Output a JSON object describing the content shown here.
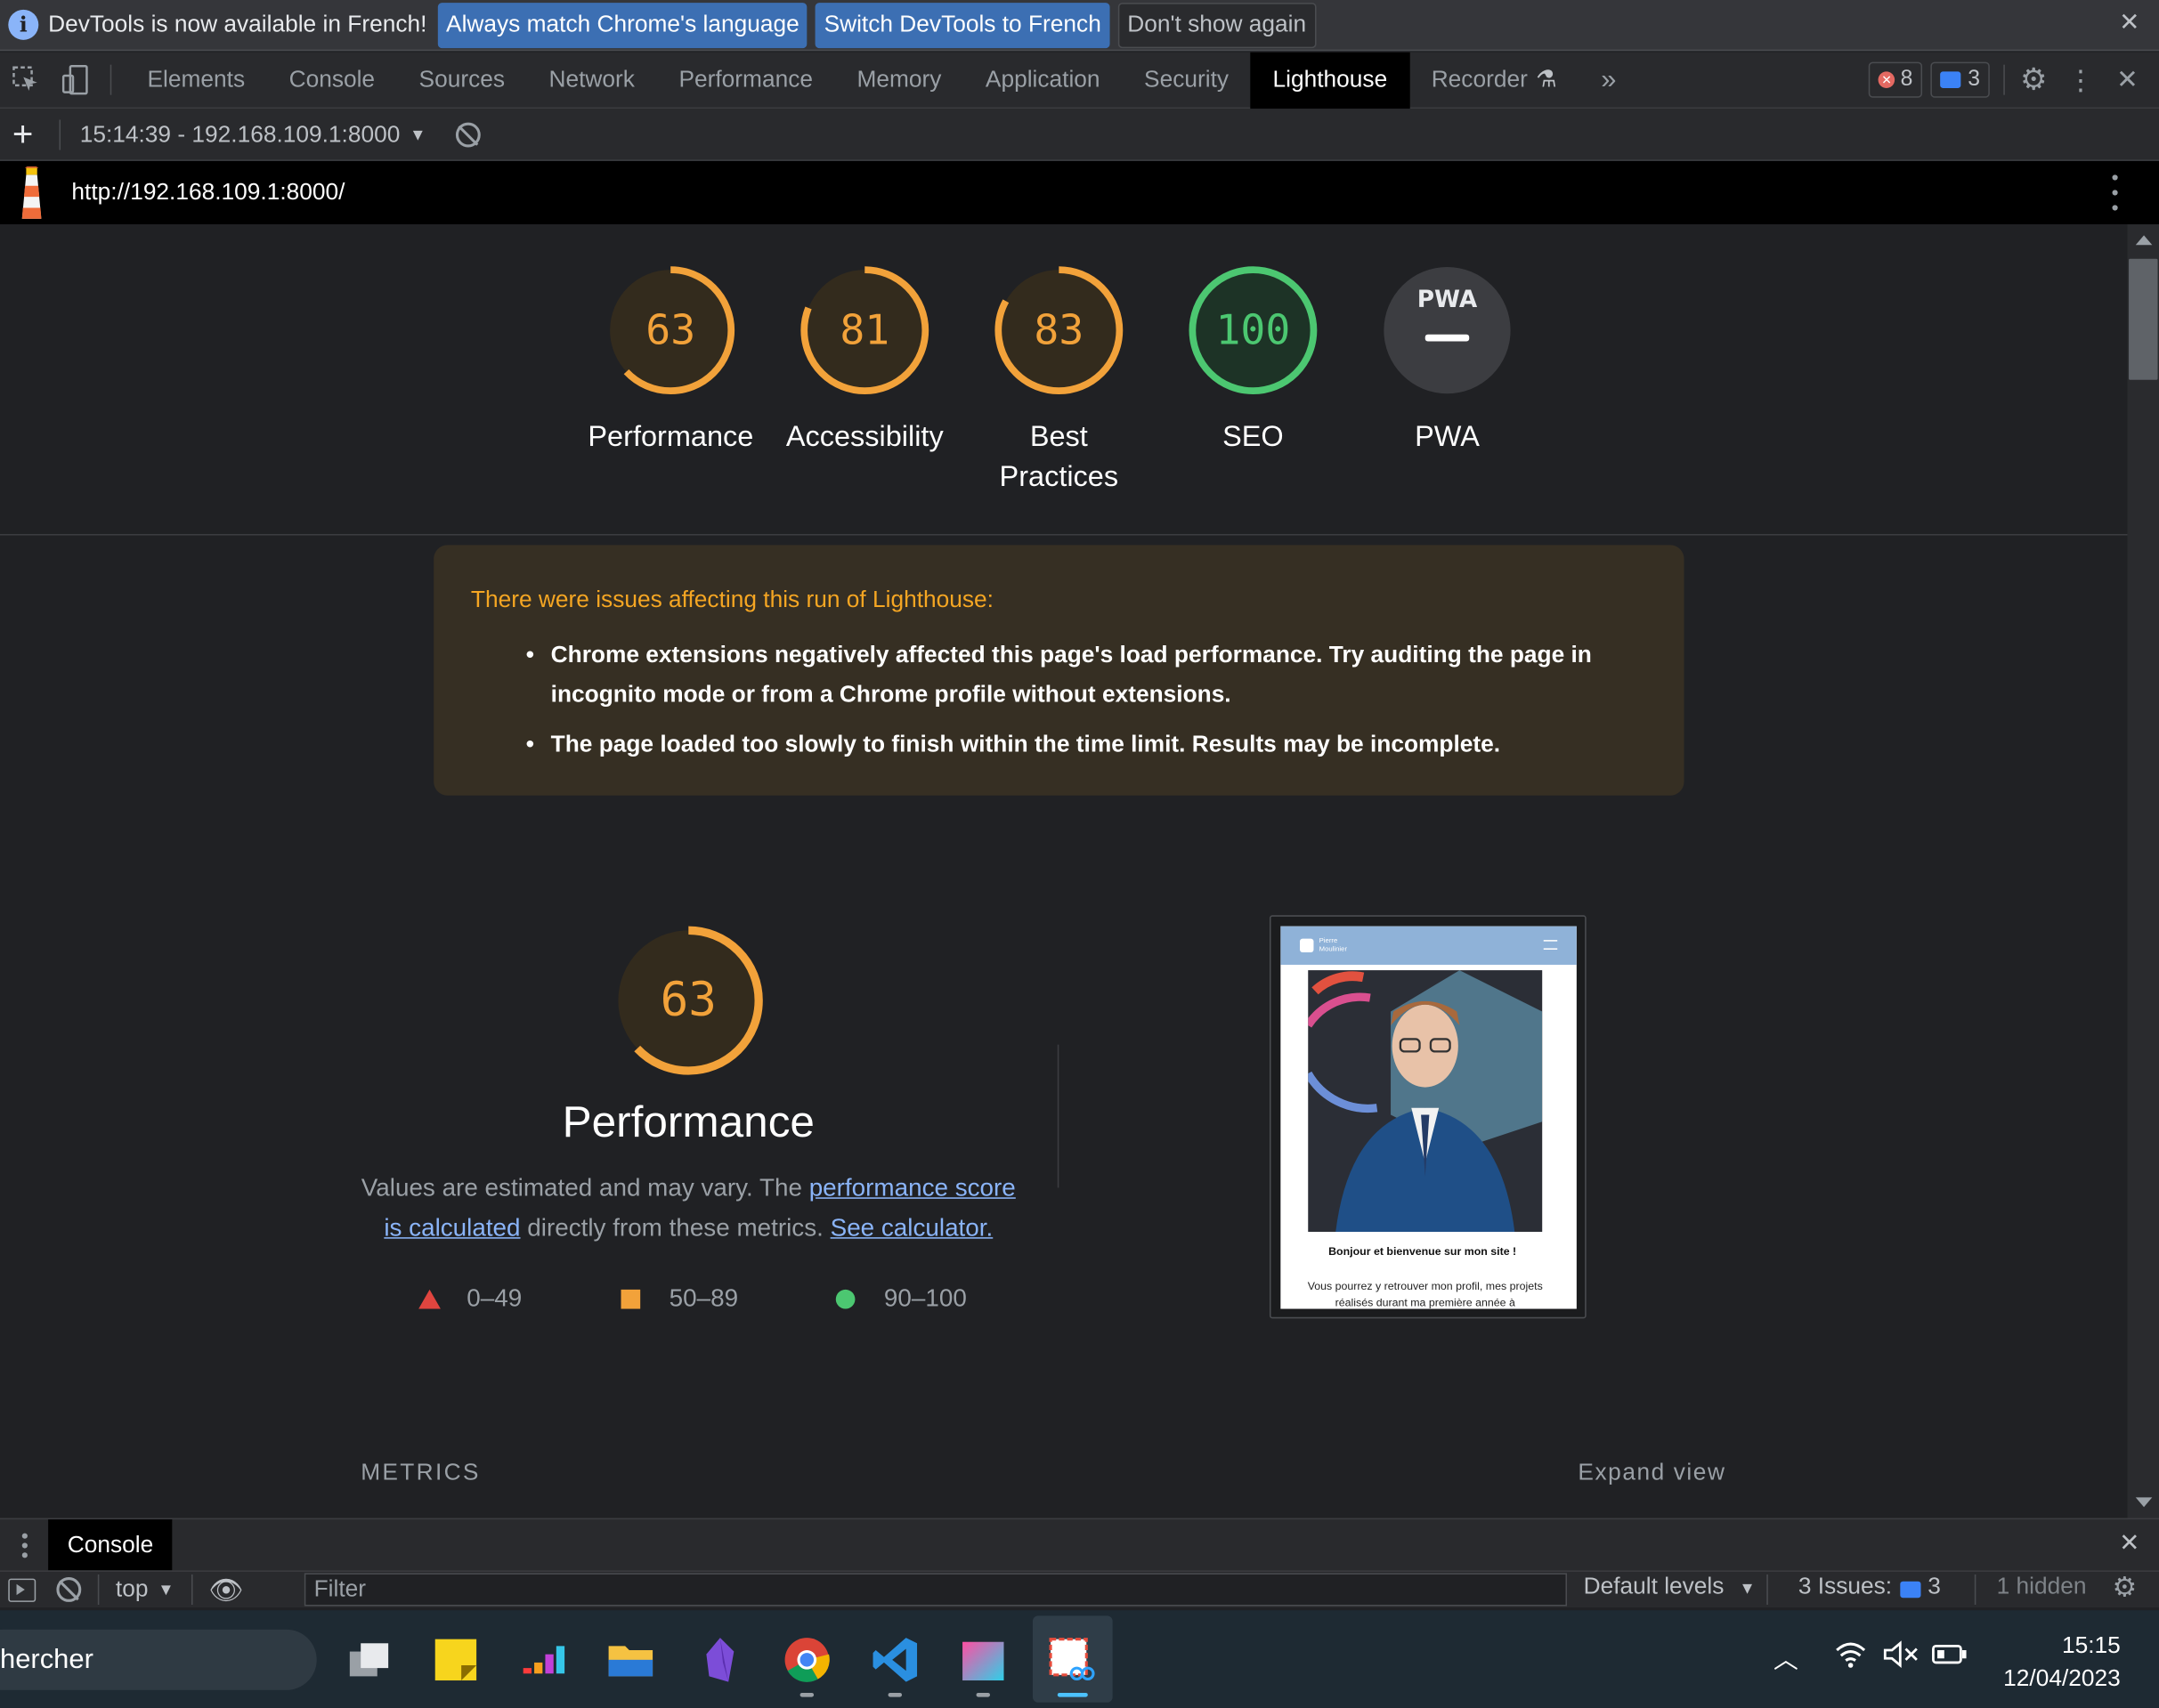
{
  "infobar": {
    "message": "DevTools is now available in French!",
    "btn_match": "Always match Chrome's language",
    "btn_switch": "Switch DevTools to French",
    "btn_dismiss": "Don't show again"
  },
  "tabs": [
    "Elements",
    "Console",
    "Sources",
    "Network",
    "Performance",
    "Memory",
    "Application",
    "Security",
    "Lighthouse",
    "Recorder"
  ],
  "active_tab": "Lighthouse",
  "counts": {
    "errors": "8",
    "messages": "3"
  },
  "report": {
    "selector": "15:14:39 - 192.168.109.1:8000",
    "url": "http://192.168.109.1:8000/"
  },
  "gauges": [
    {
      "score": "63",
      "label": "Performance",
      "value": 63,
      "color": "#f2a23a"
    },
    {
      "score": "81",
      "label": "Accessibility",
      "value": 81,
      "color": "#f2a23a"
    },
    {
      "score": "83",
      "label": "Best Practices",
      "value": 83,
      "color": "#f2a23a"
    },
    {
      "score": "100",
      "label": "SEO",
      "value": 100,
      "color": "#4cc771"
    },
    {
      "score": "PWA",
      "label": "PWA",
      "value": null,
      "color": "#9aa0a6"
    }
  ],
  "warnings": {
    "title": "There were issues affecting this run of Lighthouse:",
    "items": [
      "Chrome extensions negatively affected this page's load performance. Try auditing the page in incognito mode or from a Chrome profile without extensions.",
      "The page loaded too slowly to finish within the time limit. Results may be incomplete."
    ]
  },
  "performance": {
    "score": "63",
    "value": 63,
    "title": "Performance",
    "desc_1": "Values are estimated and may vary. The ",
    "link_1": "performance score is calculated",
    "desc_2": " directly from these metrics. ",
    "link_2": "See calculator.",
    "legend": [
      "0–49",
      "50–89",
      "90–100"
    ]
  },
  "screenshot": {
    "brand": "Pierre Moulinier",
    "headline": "Bonjour et bienvenue sur mon site !",
    "body": "Vous pourrez y retrouver mon profil, mes projets réalisés durant ma première année à"
  },
  "sections": {
    "metrics": "METRICS",
    "expand": "Expand view"
  },
  "drawer": {
    "tab": "Console",
    "context": "top",
    "filter_placeholder": "Filter",
    "levels": "Default levels",
    "issues_label": "3 Issues:",
    "issues_count": "3",
    "hidden": "1 hidden"
  },
  "taskbar": {
    "search": "hercher",
    "time": "15:15",
    "date": "12/04/2023"
  },
  "colors": {
    "average": "#f2a23a",
    "pass": "#4cc771",
    "fail": "#e0453f",
    "link": "#8ab4f8"
  }
}
